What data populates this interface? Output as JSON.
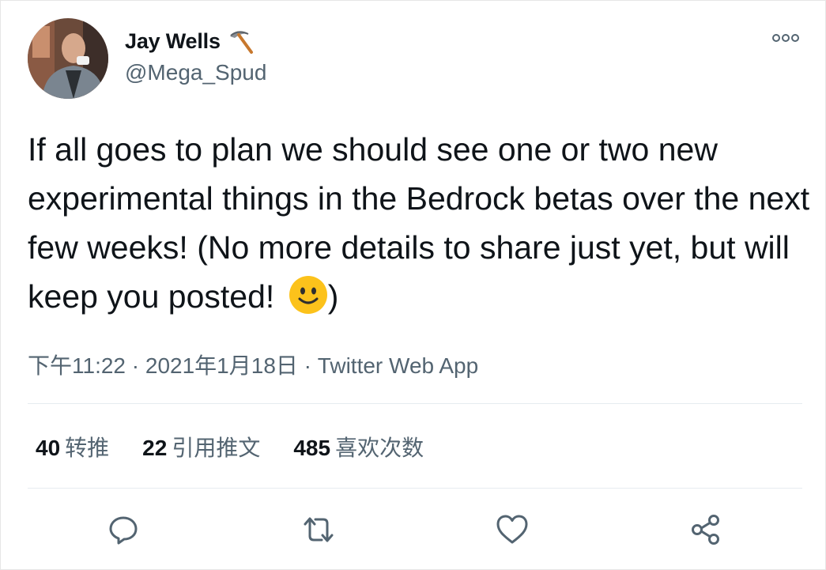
{
  "author": {
    "display_name": "Jay Wells",
    "handle": "@Mega_Spud",
    "badge_icon": "pickaxe-icon"
  },
  "tweet": {
    "text": "If all goes to plan we should see one or two new experimental things in the Bedrock betas over the next few weeks! (No more details to share just yet, but will keep you posted! ",
    "text_end": ")",
    "emoji": "slightly-smiling-face"
  },
  "meta": {
    "time": "下午11:22",
    "sep1": " · ",
    "date": "2021年1月18日",
    "sep2": " · ",
    "source": "Twitter Web App"
  },
  "stats": {
    "retweets": {
      "count": "40",
      "label": "转推"
    },
    "quotes": {
      "count": "22",
      "label": "引用推文"
    },
    "likes": {
      "count": "485",
      "label": "喜欢次数"
    }
  },
  "actions": [
    "reply-icon",
    "retweet-icon",
    "like-icon",
    "share-icon"
  ],
  "colors": {
    "text": "#0f1419",
    "muted": "#536471",
    "divider": "#e6ecf0",
    "icon": "#536471",
    "emoji": "#fcc21b"
  }
}
